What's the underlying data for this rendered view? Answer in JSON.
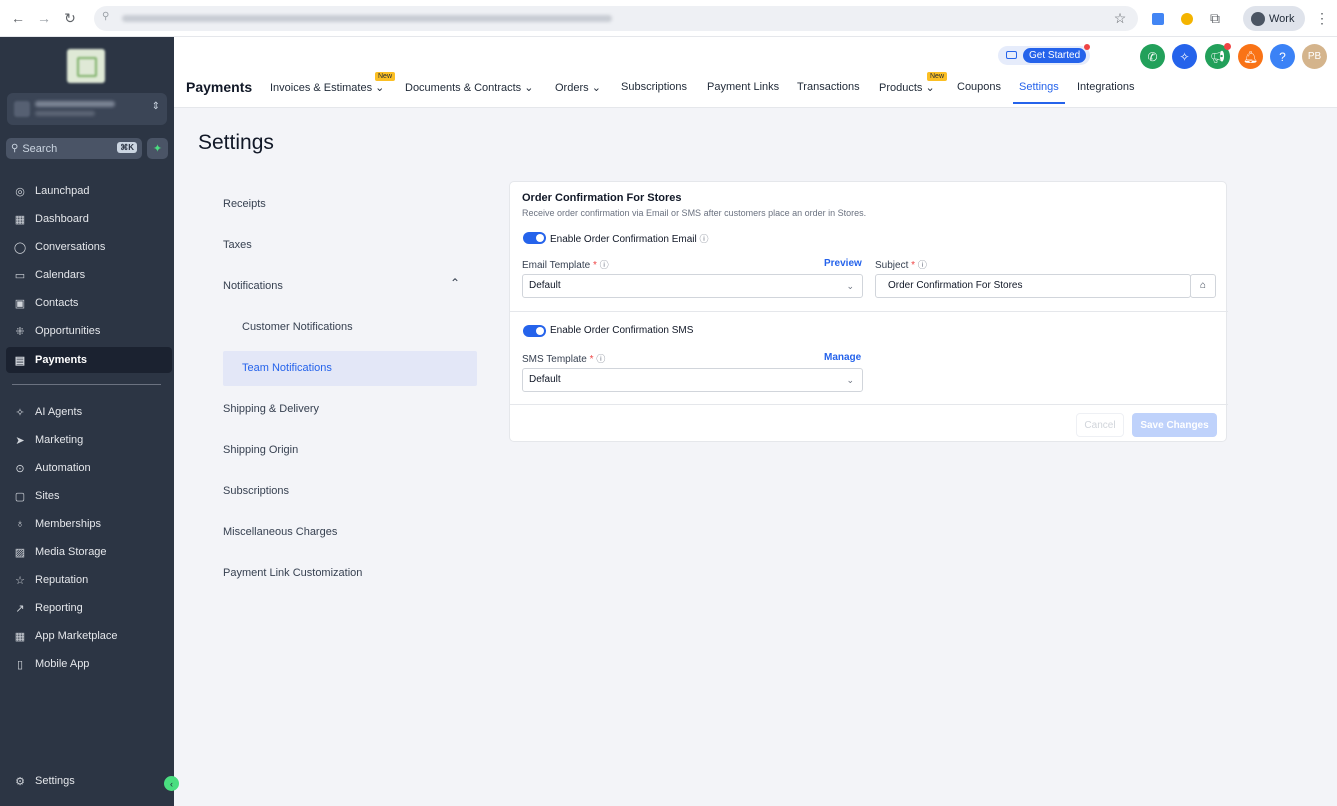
{
  "browser": {
    "profile_label": "Work",
    "icons": [
      "back-icon",
      "forward-icon",
      "reload-icon",
      "site-info-icon",
      "star-icon",
      "extension-icon",
      "extension-icon",
      "puzzle-icon",
      "menu-icon"
    ]
  },
  "sidebar": {
    "search_placeholder": "Search",
    "search_shortcut": "⌘K",
    "items": [
      {
        "label": "Launchpad",
        "icon": "rocket-icon"
      },
      {
        "label": "Dashboard",
        "icon": "grid-icon"
      },
      {
        "label": "Conversations",
        "icon": "chat-icon"
      },
      {
        "label": "Calendars",
        "icon": "calendar-icon"
      },
      {
        "label": "Contacts",
        "icon": "contacts-icon"
      },
      {
        "label": "Opportunities",
        "icon": "opportunities-icon"
      },
      {
        "label": "Payments",
        "icon": "receipt-icon"
      }
    ],
    "items2": [
      {
        "label": "AI Agents",
        "icon": "sparkle-icon"
      },
      {
        "label": "Marketing",
        "icon": "send-icon"
      },
      {
        "label": "Automation",
        "icon": "automation-icon"
      },
      {
        "label": "Sites",
        "icon": "sites-icon"
      },
      {
        "label": "Memberships",
        "icon": "award-icon"
      },
      {
        "label": "Media Storage",
        "icon": "image-icon"
      },
      {
        "label": "Reputation",
        "icon": "star-icon"
      },
      {
        "label": "Reporting",
        "icon": "trend-icon"
      },
      {
        "label": "App Marketplace",
        "icon": "apps-icon"
      },
      {
        "label": "Mobile App",
        "icon": "phone-icon"
      }
    ],
    "settings_label": "Settings"
  },
  "topbar": {
    "brand": "Payments",
    "get_started": "Get Started",
    "avatar_initials": "PB",
    "tabs": [
      {
        "label": "Invoices & Estimates",
        "badge": "New",
        "chevron": true
      },
      {
        "label": "Documents & Contracts",
        "chevron": true
      },
      {
        "label": "Orders",
        "chevron": true
      },
      {
        "label": "Subscriptions"
      },
      {
        "label": "Payment Links"
      },
      {
        "label": "Transactions"
      },
      {
        "label": "Products",
        "badge": "New",
        "chevron": true
      },
      {
        "label": "Coupons"
      },
      {
        "label": "Settings",
        "active": true
      },
      {
        "label": "Integrations"
      }
    ]
  },
  "settings": {
    "title": "Settings",
    "nav": [
      "Receipts",
      "Taxes",
      "Notifications",
      "Customer Notifications",
      "Team Notifications",
      "Shipping & Delivery",
      "Shipping Origin",
      "Subscriptions",
      "Miscellaneous Charges",
      "Payment Link Customization"
    ]
  },
  "card": {
    "title": "Order Confirmation For Stores",
    "description": "Receive order confirmation via Email or SMS after customers place an order in Stores.",
    "email_toggle_label": "Enable Order Confirmation Email",
    "email_template_label": "Email Template",
    "preview_link": "Preview",
    "email_template_value": "Default",
    "subject_label": "Subject",
    "subject_value": "Order Confirmation For Stores",
    "sms_toggle_label": "Enable Order Confirmation SMS",
    "sms_template_label": "SMS Template",
    "manage_link": "Manage",
    "sms_template_value": "Default",
    "cancel_button": "Cancel",
    "save_button": "Save Changes",
    "email_enabled": true,
    "sms_enabled": true
  },
  "colors": {
    "accent": "#2563eb",
    "sidebar": "#2c3544",
    "page": "#f3f4f8"
  }
}
